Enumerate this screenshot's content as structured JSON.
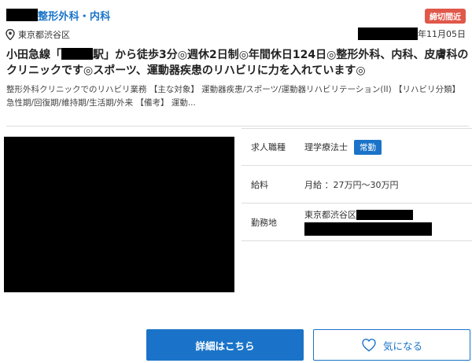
{
  "header": {
    "clinic_name": "整形外科・内科",
    "deadline_badge": "締切間近"
  },
  "location": {
    "icon": "map-pin-icon",
    "text": "東京都渋谷区"
  },
  "posted": {
    "date_suffix": "年11月05日"
  },
  "headline": {
    "part1": "小田急線「",
    "part2": "駅」から徒歩3分◎週休2日制◎年間休日124日◎整形外科、内科、皮膚科のクリニックです◎スポーツ、運動器疾患のリハビリに力を入れています◎"
  },
  "description": "整形外科クリニックでのリハビリ業務 【主な対象】 運動器疾患/スポーツ/運動器リハビリテーション(II) 【リハビリ分類】 急性期/回復期/維持期/生活期/外来 【備考】 運動...",
  "info": {
    "job_type_label": "求人職種",
    "job_type_value": "理学療法士",
    "employment_badge": "常勤",
    "salary_label": "給料",
    "salary_value": "月給 ：27万円〜30万円",
    "location_label": "勤務地",
    "location_value": "東京都渋谷区"
  },
  "buttons": {
    "detail": "詳細はこちら",
    "favorite": "気になる",
    "favorite_icon": "heart-icon"
  },
  "colors": {
    "accent": "#1a73c8",
    "deadline": "#e0584a"
  }
}
